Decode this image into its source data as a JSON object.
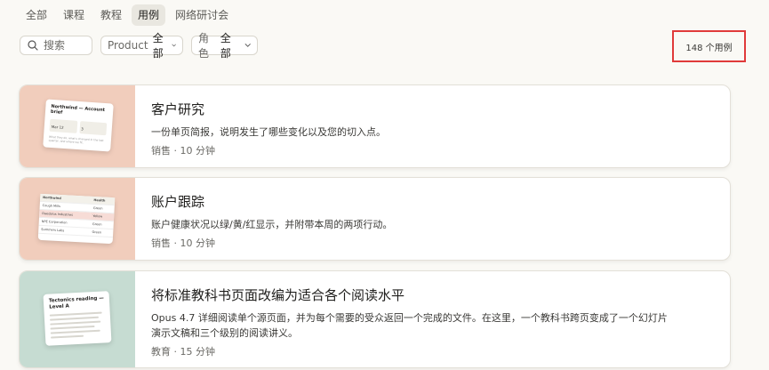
{
  "tabs": [
    {
      "label": "全部",
      "active": false
    },
    {
      "label": "课程",
      "active": false
    },
    {
      "label": "教程",
      "active": false
    },
    {
      "label": "用例",
      "active": true
    },
    {
      "label": "网络研讨会",
      "active": false
    }
  ],
  "search": {
    "placeholder": "搜索",
    "icon": "search-icon"
  },
  "filters": {
    "product": {
      "label": "Product",
      "value": "全部"
    },
    "role": {
      "label": "角色",
      "value": "全部"
    }
  },
  "result_count": "148 个用例",
  "colors": {
    "highlight_border": "#e03a3a",
    "thumb_peach": "#f1cdbc",
    "thumb_sage": "#c6dcd2"
  },
  "cards": [
    {
      "title": "客户研究",
      "description": "一份单页简报，说明发生了哪些变化以及您的切入点。",
      "meta": "销售 · 10 分钟",
      "preview": {
        "heading": "Northwind — Account brief",
        "cell_1": "Mar 12",
        "cell_2": "3",
        "footer": "What they do, what's changed in the last quarter, and where we fit."
      }
    },
    {
      "title": "账户跟踪",
      "description": "账户健康状况以绿/黄/红显示，并附带本周的两项行动。",
      "meta": "销售 · 10 分钟",
      "preview": {
        "header": [
          "Northwind",
          "Health"
        ],
        "rows": [
          [
            "Cough Mills",
            "Green"
          ],
          [
            "Daedalus Industries",
            "Yellow"
          ],
          [
            "NPE Corporation",
            "Green"
          ],
          [
            "Summers Labs",
            "Green"
          ]
        ]
      }
    },
    {
      "title": "将标准教科书页面改编为适合各个阅读水平",
      "description": "Opus 4.7 详细阅读单个源页面，并为每个需要的受众返回一个完成的文件。在这里，一个教科书跨页变成了一个幻灯片演示文稿和三个级别的阅读讲义。",
      "meta": "教育 · 15 分钟",
      "preview": {
        "heading": "Tectonics reading — Level A"
      }
    }
  ]
}
